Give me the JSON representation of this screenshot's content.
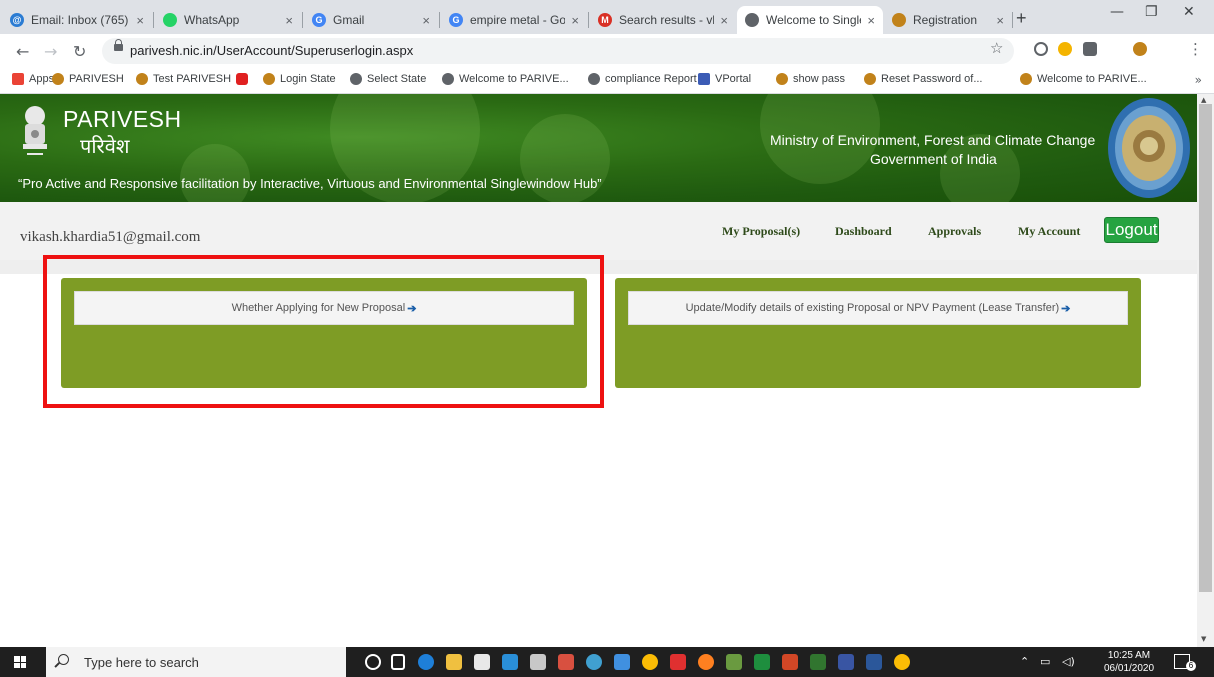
{
  "browser": {
    "tabs": [
      {
        "label": "Email: Inbox (765)",
        "close": "×",
        "color": "#2b7cd3"
      },
      {
        "label": "WhatsApp",
        "close": "×",
        "color": "#25d366"
      },
      {
        "label": "Gmail",
        "close": "×",
        "color": "#4285f4"
      },
      {
        "label": "empire metal - Go",
        "close": "×",
        "color": "#4285f4"
      },
      {
        "label": "Search results - vk",
        "close": "×",
        "color": "#d93025"
      },
      {
        "label": "Welcome to Single",
        "close": "×",
        "color": "#5f6368"
      },
      {
        "label": "Registration",
        "close": "×",
        "color": "#c1821a"
      }
    ],
    "active_tab": 5,
    "new_tab": "+",
    "url": "parivesh.nic.in/UserAccount/Superuserlogin.aspx",
    "bookmarks": [
      {
        "label": "Apps",
        "color": "#ea4335"
      },
      {
        "label": "PARIVESH",
        "color": "#c1821a"
      },
      {
        "label": "Test PARIVESH",
        "color": "#c1821a"
      },
      {
        "label": "",
        "color": "#e02020"
      },
      {
        "label": "Login State",
        "color": "#c1821a"
      },
      {
        "label": "Select State",
        "color": "#5f6368"
      },
      {
        "label": "Welcome to PARIVE...",
        "color": "#5f6368"
      },
      {
        "label": "compliance Report",
        "color": "#5f6368"
      },
      {
        "label": "VPortal",
        "color": "#3b5bb5"
      },
      {
        "label": "show pass",
        "color": "#c1821a"
      },
      {
        "label": "Reset Password of...",
        "color": "#c1821a"
      },
      {
        "label": "Welcome to PARIVE...",
        "color": "#c1821a"
      }
    ],
    "bookmarks_more": "»"
  },
  "header": {
    "brand_en": "PARIVESH",
    "brand_hi": "परिवेश",
    "tagline": "“Pro Active and Responsive facilitation by Interactive, Virtuous and Environmental Singlewindow Hub”",
    "ministry": "Ministry of Environment, Forest and Climate Change",
    "government": "Government of India"
  },
  "userbar": {
    "email": "vikash.khardia51@gmail.com",
    "nav": [
      "My Proposal(s)",
      "Dashboard",
      "Approvals",
      "My Account"
    ],
    "logout": "Logout"
  },
  "panels": {
    "new_proposal": "Whether Applying for New Proposal",
    "update_proposal": "Update/Modify details of existing Proposal or NPV Payment (Lease Transfer)",
    "arrow": "➔"
  },
  "taskbar": {
    "search_placeholder": "Type here to search",
    "time": "10:25 AM",
    "date": "06/01/2020",
    "notifications": "6"
  },
  "colors": {
    "header_green": "#2a6a13",
    "panel_olive": "#7e9c25",
    "highlight_red": "#ee1111",
    "logout_green": "#26a341"
  }
}
